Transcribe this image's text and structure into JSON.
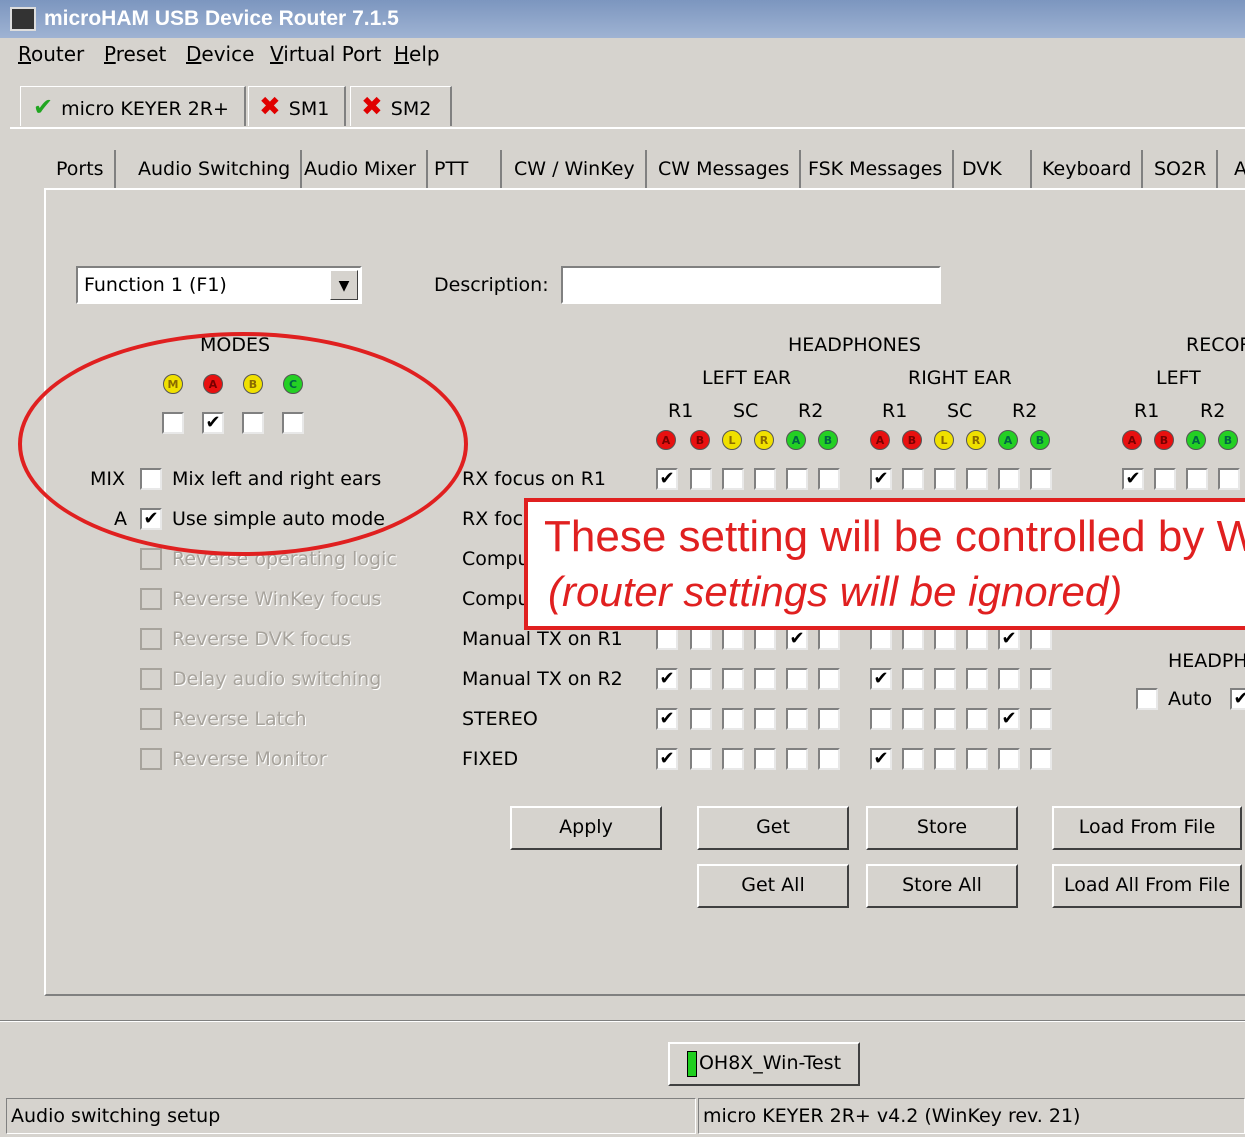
{
  "window": {
    "title": "microHAM USB Device Router 7.1.5"
  },
  "menu": [
    "Router",
    "Preset",
    "Device",
    "Virtual Port",
    "Help"
  ],
  "device_tabs": [
    {
      "label": "micro KEYER 2R+",
      "status": "ok"
    },
    {
      "label": "SM1",
      "status": "error"
    },
    {
      "label": "SM2",
      "status": "error"
    }
  ],
  "page_tabs": [
    "Ports",
    "Audio Switching",
    "Audio Mixer",
    "PTT",
    "CW / WinKey",
    "CW Messages",
    "FSK Messages",
    "DVK",
    "Keyboard",
    "SO2R",
    "A"
  ],
  "function_select": {
    "value": "Function 1  (F1)"
  },
  "description": {
    "label": "Description:",
    "value": ""
  },
  "modes": {
    "title": "MODES",
    "indicators": [
      {
        "letter": "M",
        "color": "yellow"
      },
      {
        "letter": "A",
        "color": "red"
      },
      {
        "letter": "B",
        "color": "yellow"
      },
      {
        "letter": "C",
        "color": "green"
      }
    ],
    "checked": [
      false,
      true,
      false,
      false
    ]
  },
  "options": [
    {
      "prefix": "MIX",
      "label": "Mix left and right ears",
      "checked": false,
      "enabled": true
    },
    {
      "prefix": "A",
      "label": "Use simple auto mode",
      "checked": true,
      "enabled": true
    },
    {
      "prefix": "",
      "label": "Reverse operating logic",
      "checked": false,
      "enabled": false
    },
    {
      "prefix": "",
      "label": "Reverse WinKey focus",
      "checked": false,
      "enabled": false
    },
    {
      "prefix": "",
      "label": "Reverse DVK focus",
      "checked": false,
      "enabled": false
    },
    {
      "prefix": "",
      "label": "Delay audio switching",
      "checked": false,
      "enabled": false
    },
    {
      "prefix": "",
      "label": "Reverse Latch",
      "checked": false,
      "enabled": false
    },
    {
      "prefix": "",
      "label": "Reverse Monitor",
      "checked": false,
      "enabled": false
    }
  ],
  "headphones": {
    "title": "HEADPHONES",
    "left_ear": "LEFT EAR",
    "right_ear": "RIGHT EAR",
    "col_groups": [
      "R1",
      "SC",
      "R2"
    ],
    "col_letters": [
      "A",
      "B",
      "L",
      "R",
      "A",
      "B"
    ],
    "recording_title": "RECOR",
    "recording_left": "LEFT",
    "recording_groups": [
      "R1",
      "R2"
    ],
    "recording_letters": [
      "A",
      "B",
      "A",
      "B"
    ]
  },
  "matrix_rows": [
    {
      "label": "RX focus on R1",
      "left": [
        1,
        0,
        0,
        0,
        0,
        0
      ],
      "right": [
        1,
        0,
        0,
        0,
        0,
        0
      ],
      "rec": [
        1,
        0,
        0,
        0
      ]
    },
    {
      "label": "RX foc",
      "left": [],
      "right": [],
      "rec": []
    },
    {
      "label": "Compu",
      "left": [],
      "right": [],
      "rec": []
    },
    {
      "label": "Compu",
      "left": [],
      "right": [],
      "rec": []
    },
    {
      "label": "Manual TX on R1",
      "left": [
        0,
        0,
        0,
        0,
        1,
        0
      ],
      "right": [
        0,
        0,
        0,
        0,
        1,
        0
      ],
      "rec": []
    },
    {
      "label": "Manual TX on R2",
      "left": [
        1,
        0,
        0,
        0,
        0,
        0
      ],
      "right": [
        1,
        0,
        0,
        0,
        0,
        0
      ],
      "rec": []
    },
    {
      "label": "STEREO",
      "left": [
        1,
        0,
        0,
        0,
        0,
        0
      ],
      "right": [
        0,
        0,
        0,
        0,
        1,
        0
      ],
      "rec": []
    },
    {
      "label": "FIXED",
      "left": [
        1,
        0,
        0,
        0,
        0,
        0
      ],
      "right": [
        1,
        0,
        0,
        0,
        0,
        0
      ],
      "rec": []
    }
  ],
  "right_headph": {
    "label": "HEADPH",
    "auto_label": "Auto",
    "auto_checked": false,
    "next_checked": true
  },
  "buttons": {
    "apply": "Apply",
    "get": "Get",
    "store": "Store",
    "load_from_file": "Load From File",
    "get_all": "Get All",
    "store_all": "Store All",
    "load_all_from_file": "Load All From File"
  },
  "overlay": {
    "line1": "These setting will be controlled by W",
    "line2": "(router settings will be ignored)",
    "color": "#e02020"
  },
  "wintest_button": "OH8X_Win-Test",
  "status_bar": {
    "left": "Audio switching setup",
    "right": "micro KEYER 2R+ v4.2 (WinKey rev. 21)"
  }
}
